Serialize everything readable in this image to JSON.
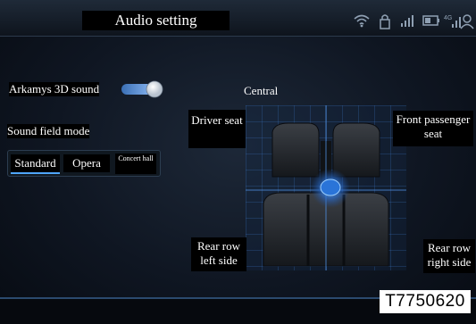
{
  "header": {
    "title": "Audio setting"
  },
  "status_icons": [
    "wifi-icon",
    "lock-icon",
    "signal-icon",
    "battery-icon",
    "4g-signal-icon",
    "user-icon"
  ],
  "arkamys": {
    "label": "Arkamys 3D sound",
    "enabled": true
  },
  "sound_field": {
    "label": "Sound field mode",
    "options": [
      "Standard",
      "Opera",
      "Concert hall"
    ],
    "selected": "Standard"
  },
  "zones": {
    "central": "Central",
    "driver": "Driver seat",
    "front_passenger": "Front passenger seat",
    "rear_left": "Rear row left side",
    "rear_right": "Rear row right side"
  },
  "footer": {
    "code": "T7750620"
  },
  "colors": {
    "accent": "#4fa6ff"
  }
}
